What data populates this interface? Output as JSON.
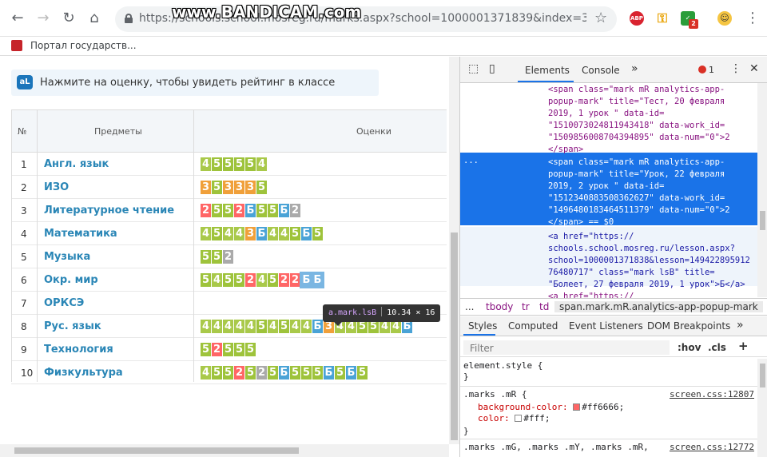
{
  "browser": {
    "url": "https://schools.school.mosreg.ru/marks.aspx?school=1000001371839&index=3&tab=pe...",
    "watermark": "www.BANDICAM.com",
    "ext_abp": "ABP",
    "ext_badge": "2",
    "bookmark": "Портал государств..."
  },
  "page": {
    "banner_logo": "aL",
    "banner": "Нажмите на оценку, чтобы увидеть рейтинг в классе",
    "headers": {
      "num": "№",
      "subject": "Предметы",
      "marks": "Оценки"
    },
    "rows": [
      {
        "num": "1",
        "subject": "Англ. язык",
        "marks": [
          "4",
          "5",
          "5",
          "5",
          "5",
          "4"
        ]
      },
      {
        "num": "2",
        "subject": "ИЗО",
        "marks": [
          "3",
          "5",
          "3",
          "3",
          "3",
          "5"
        ]
      },
      {
        "num": "3",
        "subject": "Литературное чтение",
        "marks": [
          "2",
          "5",
          "5",
          "2",
          "Б",
          "5",
          "5",
          "Б",
          "2"
        ]
      },
      {
        "num": "4",
        "subject": "Математика",
        "marks": [
          "4",
          "5",
          "4",
          "4",
          "3",
          "Б",
          "4",
          "4",
          "5",
          "Б",
          "5"
        ]
      },
      {
        "num": "5",
        "subject": "Музыка",
        "marks": [
          "5",
          "5",
          "2"
        ]
      },
      {
        "num": "6",
        "subject": "Окр. мир",
        "marks": [
          "5",
          "4",
          "5",
          "5",
          "2",
          "4",
          "5",
          "2",
          "2",
          "Б",
          "Б"
        ]
      },
      {
        "num": "7",
        "subject": "ОРКСЭ",
        "marks": []
      },
      {
        "num": "8",
        "subject": "Рус. язык",
        "marks": [
          "4",
          "4",
          "4",
          "4",
          "4",
          "5",
          "4",
          "5",
          "4",
          "4",
          "Б",
          "3",
          "4",
          "4",
          "5",
          "5",
          "4",
          "4",
          "Б"
        ]
      },
      {
        "num": "9",
        "subject": "Технология",
        "marks": [
          "5",
          "2",
          "5",
          "5",
          "5"
        ]
      },
      {
        "num": "10",
        "subject": "Физкультура",
        "marks": [
          "4",
          "5",
          "5",
          "2",
          "5",
          "2",
          "5",
          "Б",
          "5",
          "5",
          "5",
          "Б",
          "5",
          "Б",
          "5"
        ]
      }
    ],
    "tooltip": {
      "selector": "a.mark.lsB",
      "size": "10.34 × 16"
    }
  },
  "devtools": {
    "tabs": [
      "Elements",
      "Console"
    ],
    "errors": "1",
    "code_lines": [
      {
        "t": "<span class=\"mark mR analytics-app-",
        "kind": "tag"
      },
      {
        "t": "popup-mark\" title=\"Тест, 20 февраля",
        "kind": "tag"
      },
      {
        "t": "2019, 1 урок \" data-id=",
        "kind": "tag"
      },
      {
        "t": "\"1510073024811943418\" data-work_id=",
        "kind": "tag"
      },
      {
        "t": "\"1509856008704394895\" data-num=\"0\">2",
        "kind": "tag"
      },
      {
        "t": "</span>",
        "kind": "tag"
      },
      {
        "t": "<span class=\"mark mR analytics-app-",
        "kind": "sel"
      },
      {
        "t": "popup-mark\" title=\"Урок, 22 февраля",
        "kind": "sel"
      },
      {
        "t": "2019, 2 урок \" data-id=",
        "kind": "sel"
      },
      {
        "t": "\"1512340883508362627\" data-work_id=",
        "kind": "sel"
      },
      {
        "t": "\"1496480183464511379\" data-num=\"0\">2",
        "kind": "sel"
      },
      {
        "t": "</span> == $0",
        "kind": "sel"
      },
      {
        "t": "<a href=\"https://",
        "kind": "hov"
      },
      {
        "t": "schools.school.mosreg.ru/lesson.aspx?",
        "kind": "hov"
      },
      {
        "t": "school=1000001371838&lesson=149422895912",
        "kind": "hov"
      },
      {
        "t": "76480717\" class=\"mark lsB\" title=",
        "kind": "hov"
      },
      {
        "t": "\"Болеет, 27 февраля 2019, 1 урок\">Б</a>",
        "kind": "hov"
      },
      {
        "t": "<a href=\"https://",
        "kind": "tag"
      }
    ],
    "ellipsis": "...",
    "breadcrumbs": [
      "...",
      "tbody",
      "tr",
      "td",
      "span.mark.mR.analytics-app-popup-mark"
    ],
    "style_tabs": [
      "Styles",
      "Computed",
      "Event Listeners",
      "DOM Breakpoints"
    ],
    "filter_placeholder": "Filter",
    "hov": ":hov",
    "cls": ".cls",
    "rules": {
      "element_style": "element.style {",
      "close": "}",
      "marks_sel": ".marks .mR {",
      "marks_src": "screen.css:12807",
      "bg_prop": "background-color:",
      "bg_val": "#ff6666;",
      "bg_color": "#ff6666",
      "color_prop": "color:",
      "color_val": "#fff;",
      "color_color": "#ffffff",
      "next_sel": ".marks .mG, .marks .mY, .marks .mR,",
      "next_src": "screen.css:12772"
    }
  }
}
